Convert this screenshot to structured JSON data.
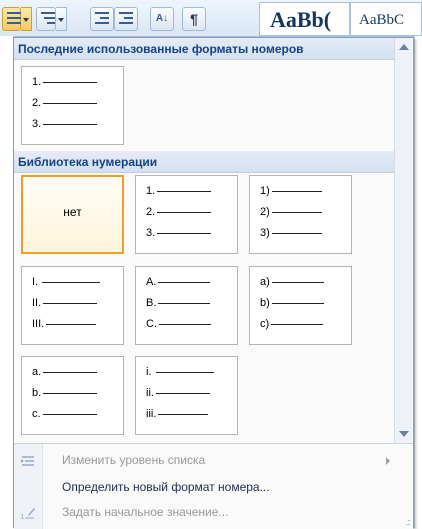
{
  "ribbon": {
    "style_1": "AaBb(",
    "style_2": "AaBbC",
    "sort_icon_text": "A↓",
    "pilcrow": "¶"
  },
  "panel": {
    "recent_header": "Последние использованные форматы номеров",
    "library_header": "Библиотека нумерации",
    "recent_tiles": [
      {
        "markers": [
          "1.",
          "2.",
          "3."
        ]
      }
    ],
    "library_tiles": [
      {
        "none_label": "нет"
      },
      {
        "markers": [
          "1.",
          "2.",
          "3."
        ]
      },
      {
        "markers": [
          "1)",
          "2)",
          "3)"
        ]
      },
      {
        "markers": [
          "I.",
          "II.",
          "III."
        ]
      },
      {
        "markers": [
          "A.",
          "B.",
          "C."
        ]
      },
      {
        "markers": [
          "a)",
          "b)",
          "c)"
        ]
      },
      {
        "markers": [
          "a.",
          "b.",
          "c."
        ]
      },
      {
        "markers": [
          "i.",
          "ii.",
          "iii."
        ]
      }
    ],
    "menu": {
      "change_level": "Изменить уровень списка",
      "define_new": "Определить новый формат номера...",
      "set_start": "Задать начальное значение..."
    }
  },
  "colors": {
    "header_text": "#15428b",
    "selected_border": "#e9a12a",
    "disabled_text": "#9a9a9a"
  }
}
